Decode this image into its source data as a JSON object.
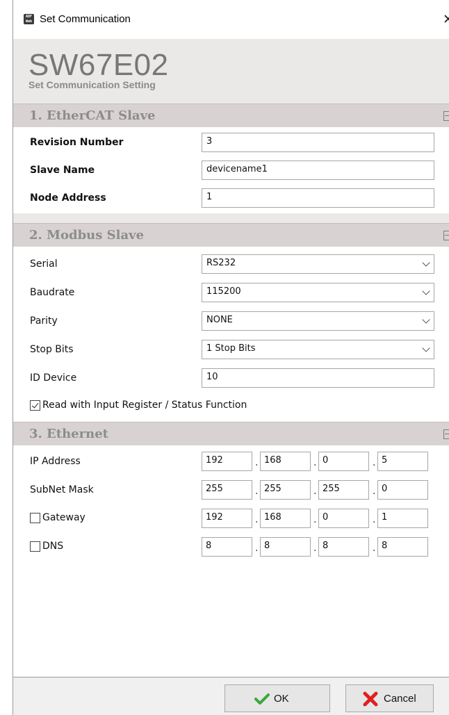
{
  "window": {
    "title": "Set Communication",
    "app_icon_text": "ADF Web"
  },
  "header": {
    "title": "SW67E02",
    "subtitle": "Set Communication Setting"
  },
  "sections": {
    "ethercat": {
      "title": "1. EtherCAT Slave",
      "revision_label": "Revision Number",
      "revision_value": "3",
      "slave_name_label": "Slave Name",
      "slave_name_value": "devicename1",
      "node_address_label": "Node Address",
      "node_address_value": "1"
    },
    "modbus": {
      "title": "2. Modbus Slave",
      "serial_label": "Serial",
      "serial_value": "RS232",
      "baudrate_label": "Baudrate",
      "baudrate_value": "115200",
      "parity_label": "Parity",
      "parity_value": "NONE",
      "stop_bits_label": "Stop Bits",
      "stop_bits_value": "1 Stop Bits",
      "id_device_label": "ID Device",
      "id_device_value": "10",
      "read_input_label": "Read with Input Register / Status Function",
      "read_input_checked": true
    },
    "ethernet": {
      "title": "3. Ethernet",
      "ip_label": "IP Address",
      "ip": [
        "192",
        "168",
        "0",
        "5"
      ],
      "subnet_label": "SubNet Mask",
      "subnet": [
        "255",
        "255",
        "255",
        "0"
      ],
      "gateway_label": "Gateway",
      "gateway_checked": false,
      "gateway": [
        "192",
        "168",
        "0",
        "1"
      ],
      "dns_label": "DNS",
      "dns_checked": false,
      "dns": [
        "8",
        "8",
        "8",
        "8"
      ]
    }
  },
  "footer": {
    "ok_label": "OK",
    "cancel_label": "Cancel"
  },
  "colors": {
    "section_bar": "#d9d2d2",
    "ok_check": "#3aa83a",
    "cancel_x": "#e02020"
  }
}
